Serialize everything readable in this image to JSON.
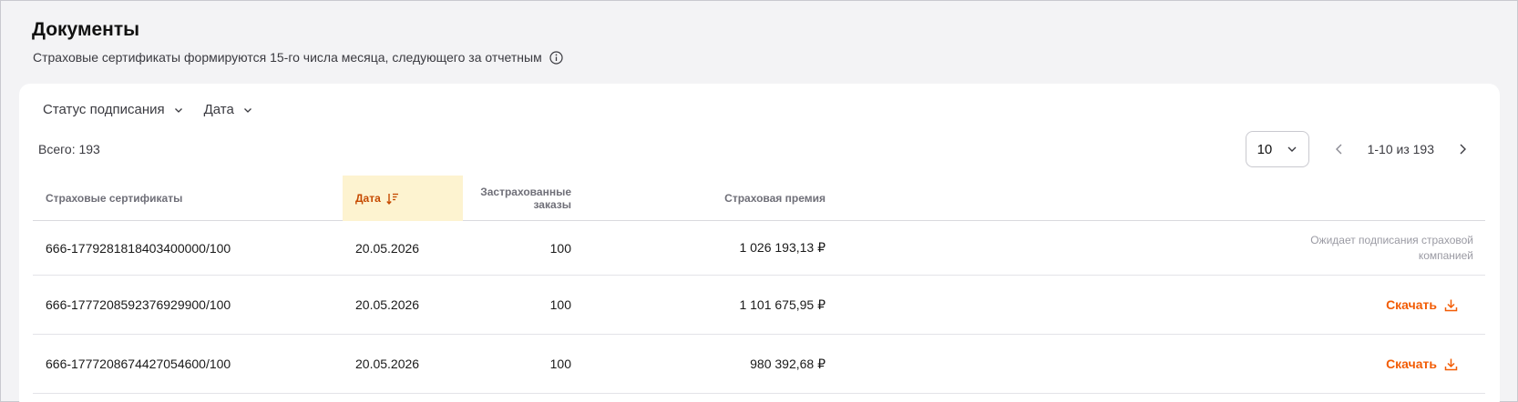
{
  "header": {
    "title": "Документы",
    "subtitle": "Страховые сертификаты формируются 15-го числа месяца, следующего за отчетным"
  },
  "filters": {
    "status_label": "Статус подписания",
    "date_label": "Дата"
  },
  "summary": {
    "total_text": "Всего: 193"
  },
  "pagination": {
    "page_size": "10",
    "range_text": "1-10 из 193"
  },
  "table": {
    "headers": {
      "certificates": "Страховые сертификаты",
      "date": "Дата",
      "orders": "Застрахованные заказы",
      "premium": "Страховая премия"
    },
    "rows": [
      {
        "certificate": "666-1779281818403400000/100",
        "date": "20.05.2026",
        "orders": "100",
        "premium": "1 026 193,13 ₽",
        "status": "Ожидает подписания страховой компанией"
      },
      {
        "certificate": "666-1777208592376929900/100",
        "date": "20.05.2026",
        "orders": "100",
        "premium": "1 101 675,95 ₽",
        "action": "Скачать"
      },
      {
        "certificate": "666-1777208674427054600/100",
        "date": "20.05.2026",
        "orders": "100",
        "premium": "980 392,68 ₽",
        "action": "Скачать"
      }
    ]
  },
  "colors": {
    "accent": "#f25c05",
    "sorted_column_bg": "#fdf3d0",
    "sorted_column_text": "#c64a00"
  },
  "icons": {
    "info": "info-circle-icon",
    "chevron": "chevron-down-icon",
    "sort": "sort-descending-icon",
    "prev": "chevron-left-icon",
    "next": "chevron-right-icon",
    "download": "download-icon"
  }
}
